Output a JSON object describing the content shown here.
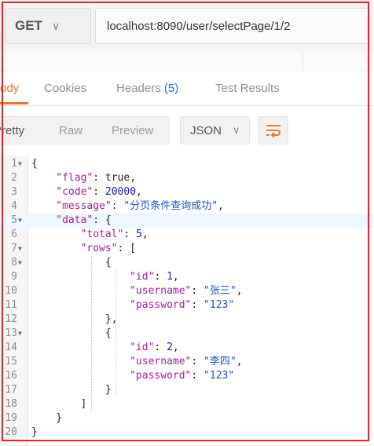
{
  "request": {
    "method": "GET",
    "url": "localhost:8090/user/selectPage/1/2"
  },
  "tabs": [
    {
      "label": "ody",
      "active": true
    },
    {
      "label": "Cookies",
      "active": false
    },
    {
      "label": "Headers",
      "count": "(5)",
      "active": false
    },
    {
      "label": "Test Results",
      "active": false
    }
  ],
  "view": {
    "modes": [
      "Pretty",
      "Raw",
      "Preview"
    ],
    "active_mode": "Pretty",
    "format": "JSON"
  },
  "colors": {
    "accent": "#e8762d",
    "frame": "#e0242a",
    "key": "#a11f9b",
    "string": "#1f52c9",
    "number": "#1a1aa6"
  },
  "editor": {
    "highlighted_line": 5,
    "lines": [
      {
        "n": "1",
        "fold": true,
        "indent": 0,
        "tokens": [
          [
            "b",
            "{"
          ]
        ]
      },
      {
        "n": "2",
        "fold": false,
        "indent": 1,
        "tokens": [
          [
            "k",
            "\"flag\""
          ],
          [
            "b",
            ": "
          ],
          [
            "b",
            "true"
          ],
          [
            "b",
            ","
          ]
        ]
      },
      {
        "n": "3",
        "fold": false,
        "indent": 1,
        "tokens": [
          [
            "k",
            "\"code\""
          ],
          [
            "b",
            ": "
          ],
          [
            "n",
            "20000"
          ],
          [
            "b",
            ","
          ]
        ]
      },
      {
        "n": "4",
        "fold": false,
        "indent": 1,
        "tokens": [
          [
            "k",
            "\"message\""
          ],
          [
            "b",
            ": "
          ],
          [
            "s",
            "\"分页条件查询成功\""
          ],
          [
            "b",
            ","
          ]
        ]
      },
      {
        "n": "5",
        "fold": true,
        "indent": 1,
        "tokens": [
          [
            "k",
            "\"data\""
          ],
          [
            "b",
            ": {"
          ]
        ]
      },
      {
        "n": "6",
        "fold": false,
        "indent": 2,
        "tokens": [
          [
            "k",
            "\"total\""
          ],
          [
            "b",
            ": "
          ],
          [
            "n",
            "5"
          ],
          [
            "b",
            ","
          ]
        ]
      },
      {
        "n": "7",
        "fold": true,
        "indent": 2,
        "tokens": [
          [
            "k",
            "\"rows\""
          ],
          [
            "b",
            ": ["
          ]
        ]
      },
      {
        "n": "8",
        "fold": true,
        "indent": 3,
        "tokens": [
          [
            "b",
            "{"
          ]
        ]
      },
      {
        "n": "9",
        "fold": false,
        "indent": 4,
        "tokens": [
          [
            "k",
            "\"id\""
          ],
          [
            "b",
            ": "
          ],
          [
            "n",
            "1"
          ],
          [
            "b",
            ","
          ]
        ]
      },
      {
        "n": "10",
        "fold": false,
        "indent": 4,
        "tokens": [
          [
            "k",
            "\"username\""
          ],
          [
            "b",
            ": "
          ],
          [
            "s",
            "\"张三\""
          ],
          [
            "b",
            ","
          ]
        ]
      },
      {
        "n": "11",
        "fold": false,
        "indent": 4,
        "tokens": [
          [
            "k",
            "\"password\""
          ],
          [
            "b",
            ": "
          ],
          [
            "s",
            "\"123\""
          ]
        ]
      },
      {
        "n": "12",
        "fold": false,
        "indent": 3,
        "tokens": [
          [
            "b",
            "},"
          ]
        ]
      },
      {
        "n": "13",
        "fold": true,
        "indent": 3,
        "tokens": [
          [
            "b",
            "{"
          ]
        ]
      },
      {
        "n": "14",
        "fold": false,
        "indent": 4,
        "tokens": [
          [
            "k",
            "\"id\""
          ],
          [
            "b",
            ": "
          ],
          [
            "n",
            "2"
          ],
          [
            "b",
            ","
          ]
        ]
      },
      {
        "n": "15",
        "fold": false,
        "indent": 4,
        "tokens": [
          [
            "k",
            "\"username\""
          ],
          [
            "b",
            ": "
          ],
          [
            "s",
            "\"李四\""
          ],
          [
            "b",
            ","
          ]
        ]
      },
      {
        "n": "16",
        "fold": false,
        "indent": 4,
        "tokens": [
          [
            "k",
            "\"password\""
          ],
          [
            "b",
            ": "
          ],
          [
            "s",
            "\"123\""
          ]
        ]
      },
      {
        "n": "17",
        "fold": false,
        "indent": 3,
        "tokens": [
          [
            "b",
            "}"
          ]
        ]
      },
      {
        "n": "18",
        "fold": false,
        "indent": 2,
        "tokens": [
          [
            "b",
            "]"
          ]
        ]
      },
      {
        "n": "19",
        "fold": false,
        "indent": 1,
        "tokens": [
          [
            "b",
            "}"
          ]
        ]
      },
      {
        "n": "20",
        "fold": false,
        "indent": 0,
        "tokens": [
          [
            "b",
            "}"
          ]
        ]
      }
    ]
  }
}
